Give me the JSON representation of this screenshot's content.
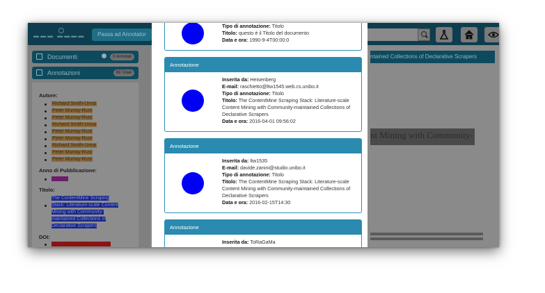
{
  "app": {
    "passa_button": "Passa ad Annotator"
  },
  "sidebar": {
    "documenti": {
      "label": "Documenti",
      "badge": "0 Annotati"
    },
    "annotazioni": {
      "label": "Annotazioni",
      "badge": "69 Totali"
    },
    "metadata": {
      "autore_heading": "Autore:",
      "authors": [
        "Richard Smith-Unna",
        "Peter Murray-Rust",
        "Peter Murray-Rust",
        "Richard Smith-Unna",
        "Peter Murray-Rust",
        "Peter Murray-Rust",
        "Richard Smith-Unna",
        "Peter Murray-Rust",
        "Peter Murray-Rust"
      ],
      "anno_heading": "Anno di Pubblicazione:",
      "anno_value": "2016",
      "titolo_heading": "Titolo:",
      "titolo_value": "The ContentMine Scraping Stack: Literature-scale Content Mining with Community-maintained Collections of Declarative Scrapers",
      "doi_heading": "DOI:",
      "doi_value": "10.1045/november14-smith"
    }
  },
  "document_panel": {
    "header": "ntained Collections of Declarative Scrapers",
    "body_title": "nt Mining with Community-"
  },
  "modal": {
    "cards": [
      {
        "partial_top": true,
        "header": "",
        "fields": [
          {
            "k": "Tipo di annotazione:",
            "v": " Titolo"
          },
          {
            "k": "Titolo:",
            "v": " questo è il Titolo del documento"
          },
          {
            "k": "Data e ora:",
            "v": " 1990-9-4T00:00:0"
          }
        ]
      },
      {
        "header": "Annotazione",
        "fields": [
          {
            "k": "Inserita da:",
            "v": " Heisenberg"
          },
          {
            "k": "E-mail:",
            "v": " raschietto@ltw1545.web.cs.unibo.it"
          },
          {
            "k": "Tipo di annotazione:",
            "v": " Titolo"
          },
          {
            "k": "Titolo:",
            "v": " The ContentMine Scraping Stack: Literature-scale Content Mining with Community-maintained Collections of Declarative Scrapers"
          },
          {
            "k": "Data e ora:",
            "v": " 2016-04-01 09:56:02"
          }
        ]
      },
      {
        "header": "Annotazione",
        "fields": [
          {
            "k": "Inserita da:",
            "v": " ltw1535"
          },
          {
            "k": "E-mail:",
            "v": " davide.zanini@studio.unibo.it"
          },
          {
            "k": "Tipo di annotazione:",
            "v": " Titolo"
          },
          {
            "k": "Titolo:",
            "v": " The ContentMine Scraping Stack: Literature-scale Content Mining with Community-maintained Collections of Declarative Scrapers"
          },
          {
            "k": "Data e ora:",
            "v": " 2016-02-15T14:30"
          }
        ]
      },
      {
        "header": "Annotazione",
        "fields": [
          {
            "k": "Inserita da:",
            "v": " ToRaGaMa"
          }
        ]
      }
    ]
  }
}
